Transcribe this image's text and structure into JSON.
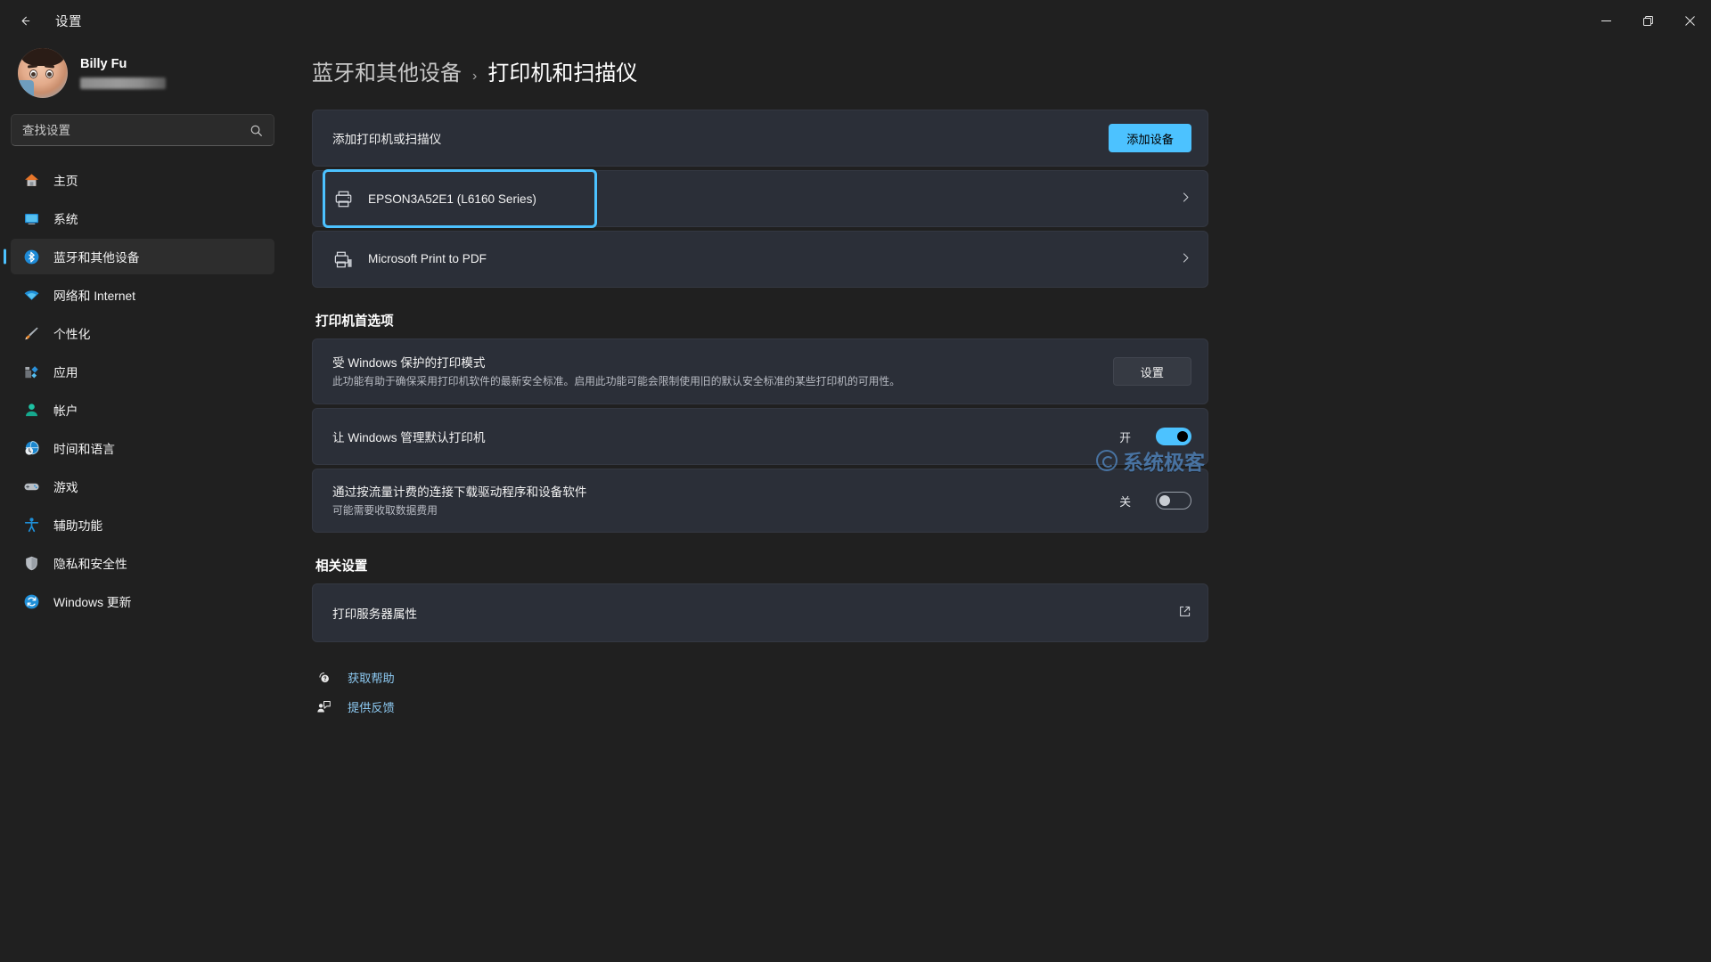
{
  "titlebar": {
    "back_label": "返回",
    "title": "设置",
    "minimize_label": "最小化",
    "maximize_label": "最大化",
    "close_label": "关闭"
  },
  "sidebar": {
    "profile": {
      "name": "Billy Fu",
      "email": ""
    },
    "search": {
      "placeholder": "查找设置",
      "value": "",
      "icon": "search-icon"
    },
    "items": [
      {
        "label": "主页",
        "icon": "home-icon",
        "active": false
      },
      {
        "label": "系统",
        "icon": "system-icon",
        "active": false
      },
      {
        "label": "蓝牙和其他设备",
        "icon": "bluetooth-icon",
        "active": true
      },
      {
        "label": "网络和 Internet",
        "icon": "network-icon",
        "active": false
      },
      {
        "label": "个性化",
        "icon": "personalization-icon",
        "active": false
      },
      {
        "label": "应用",
        "icon": "apps-icon",
        "active": false
      },
      {
        "label": "帐户",
        "icon": "accounts-icon",
        "active": false
      },
      {
        "label": "时间和语言",
        "icon": "time-language-icon",
        "active": false
      },
      {
        "label": "游戏",
        "icon": "gaming-icon",
        "active": false
      },
      {
        "label": "辅助功能",
        "icon": "accessibility-icon",
        "active": false
      },
      {
        "label": "隐私和安全性",
        "icon": "privacy-security-icon",
        "active": false
      },
      {
        "label": "Windows 更新",
        "icon": "windows-update-icon",
        "active": false
      }
    ]
  },
  "main": {
    "breadcrumb": {
      "parent": "蓝牙和其他设备",
      "separator": "›",
      "current": "打印机和扫描仪"
    },
    "add_printer": {
      "label": "添加打印机或扫描仪",
      "button_label": "添加设备"
    },
    "devices": [
      {
        "name": "EPSON3A52E1 (L6160 Series)",
        "icon": "printer-icon",
        "focused": true
      },
      {
        "name": "Microsoft Print to PDF",
        "icon": "print-to-pdf-icon",
        "focused": false
      }
    ],
    "preferences_section": {
      "title": "打印机首选项",
      "protected_mode": {
        "title": "受 Windows 保护的打印模式",
        "description": "此功能有助于确保采用打印机软件的最新安全标准。启用此功能可能会限制使用旧的默认安全标准的某些打印机的可用性。",
        "button_label": "设置"
      },
      "manage_default": {
        "title": "让 Windows 管理默认打印机",
        "state_label": "开",
        "state": "on"
      },
      "metered_download": {
        "title": "通过按流量计费的连接下载驱动程序和设备软件",
        "description": "可能需要收取数据费用",
        "state_label": "关",
        "state": "off"
      }
    },
    "related_section": {
      "title": "相关设置",
      "items": [
        {
          "label": "打印服务器属性",
          "icon": "open-external-icon"
        }
      ]
    },
    "footer_links": [
      {
        "label": "获取帮助",
        "icon": "help-icon"
      },
      {
        "label": "提供反馈",
        "icon": "feedback-icon"
      }
    ]
  },
  "watermark": {
    "text": "系统极客"
  },
  "colors": {
    "accent": "#4cc2ff",
    "window_bg": "#202020",
    "card_bg": "#2b2f38",
    "link": "#8cc8f0",
    "focus_ring": "#4cc2ff"
  }
}
